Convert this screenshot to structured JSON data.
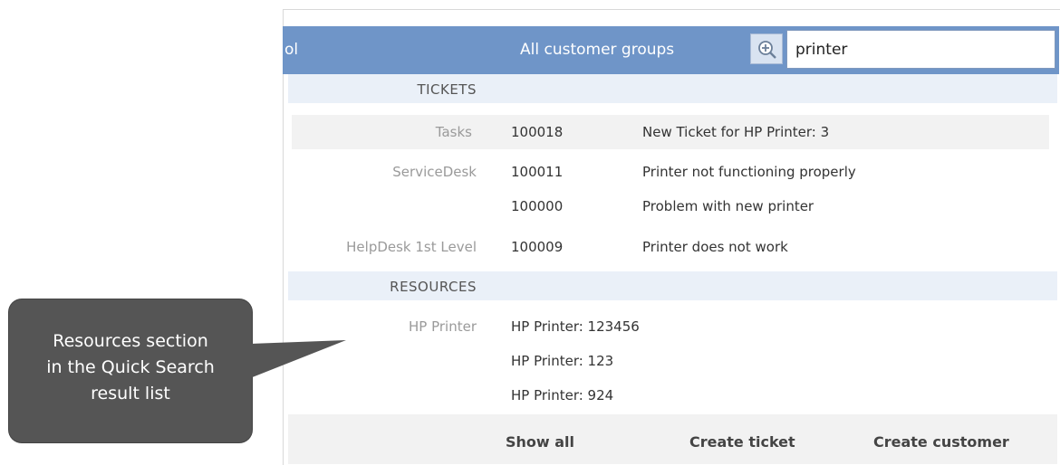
{
  "toolbar": {
    "left_text_fragment": "ol",
    "customer_groups": "All customer groups",
    "search_value": "printer",
    "zoom_icon": "zoom-in-icon"
  },
  "tickets": {
    "header": "TICKETS",
    "rows": [
      {
        "category": "Tasks",
        "number": "100018",
        "description": "New Ticket for HP Printer: 3"
      },
      {
        "category": "ServiceDesk",
        "number": "100011",
        "description": "Printer not functioning properly"
      },
      {
        "category": "",
        "number": "100000",
        "description": "Problem with new printer"
      },
      {
        "category": "HelpDesk 1st Level",
        "number": "100009",
        "description": "Printer does not work"
      }
    ]
  },
  "resources": {
    "header": "RESOURCES",
    "category": "HP Printer",
    "items": [
      "HP Printer: 123456",
      "HP Printer: 123",
      "HP Printer: 924"
    ]
  },
  "footer": {
    "show_all": "Show all",
    "create_ticket": "Create ticket",
    "create_customer": "Create customer"
  },
  "callout": {
    "lines": [
      "Resources section",
      "in the Quick Search",
      "result list"
    ]
  },
  "colors": {
    "toolbar_bg": "#6f95c8",
    "section_header_bg": "#eaf0f8",
    "highlight_row_bg": "#f2f2f2",
    "callout_bg": "#555555"
  }
}
